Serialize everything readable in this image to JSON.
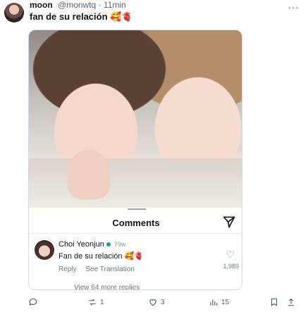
{
  "post": {
    "display_name": "moon",
    "handle_time": "@monwtq · 11min",
    "text": "fan de su relación 🥰🫀"
  },
  "comments_sheet": {
    "title": "Comments",
    "comment": {
      "author": "Choi Yeonjun",
      "time": "79w",
      "text": "Fan de su relación 🥰🫀",
      "reply_label": "Reply",
      "translate_label": "See Translation",
      "like_count": "1,989"
    },
    "view_more": "View 64 more replies"
  },
  "post_actions": {
    "replies": "",
    "reposts": "1",
    "likes": "3",
    "views": "15"
  },
  "colors": {
    "accent_dot": "#1d9e8a",
    "muted_text": "#536471"
  },
  "icons": [
    "more-icon",
    "send-icon",
    "heart-icon",
    "reply-icon",
    "repost-icon",
    "like-icon",
    "views-icon",
    "bookmark-icon",
    "share-icon"
  ]
}
